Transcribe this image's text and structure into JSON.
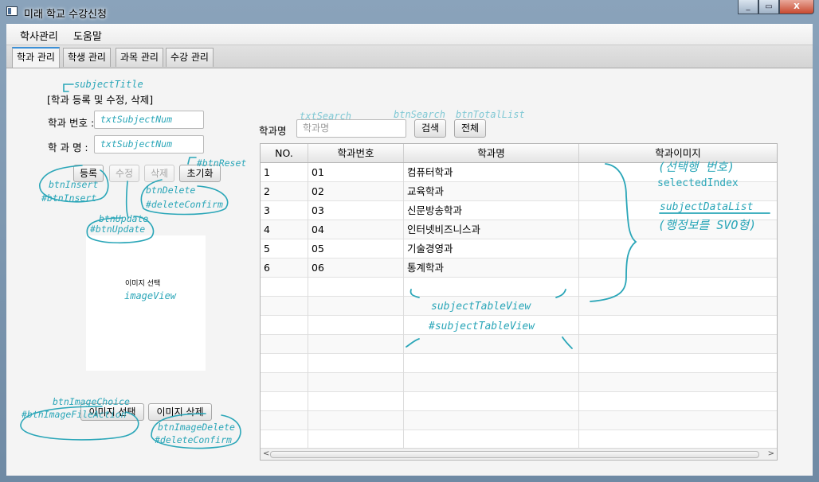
{
  "window": {
    "title": "미래 학교 수강신청",
    "minimize": "_",
    "maximize": "▭",
    "close": "X"
  },
  "menu": [
    "학사관리",
    "도움말"
  ],
  "tabs": [
    "학과 관리",
    "학생 관리",
    "과목 관리",
    "수강 관리"
  ],
  "form": {
    "title": "[학과 등록 및 수정, 삭제]",
    "num_label": "학과 번호 :",
    "name_label": "학 과 명 :",
    "num_placeholder": "txtSubjectNum",
    "name_placeholder": "txtSubjectNum",
    "buttons": {
      "insert": "등록",
      "update": "수정",
      "delete": "삭제",
      "reset": "초기화"
    },
    "image_placeholder": "이미지 선택",
    "image_choice": "이미지 선택",
    "image_delete": "이미지 삭제"
  },
  "search": {
    "label": "학과명",
    "placeholder": "학과명",
    "search_button": "검색",
    "total_button": "전체"
  },
  "table": {
    "columns": [
      "NO.",
      "학과번호",
      "학과명",
      "학과이미지"
    ],
    "rows": [
      {
        "no": "1",
        "num": "01",
        "name": "컴퓨터학과",
        "image": ""
      },
      {
        "no": "2",
        "num": "02",
        "name": "교육학과",
        "image": ""
      },
      {
        "no": "3",
        "num": "03",
        "name": "신문방송학과",
        "image": ""
      },
      {
        "no": "4",
        "num": "04",
        "name": "인터넷비즈니스과",
        "image": ""
      },
      {
        "no": "5",
        "num": "05",
        "name": "기술경영과",
        "image": ""
      },
      {
        "no": "6",
        "num": "06",
        "name": "통계학과",
        "image": ""
      }
    ],
    "empty_rows": 9,
    "scroll_left": "<",
    "scroll_right": ">"
  },
  "annotations": {
    "subjectTitle": "subjectTitle",
    "btnInsert1": "btnInsert",
    "btnInsert2": "#btnInsert",
    "btnUpdate1": "btnUpdate",
    "btnUpdate2": "#btnUpdate",
    "btnDelete1": "btnDelete",
    "btnDelete2": "#deleteConfirm",
    "btnReset": "#btnReset",
    "imageView": "imageView",
    "imgChoice1": "btnImageChoice",
    "imgChoice2": "#btnImageFileAction",
    "imgDelete1": "btnImageDelete",
    "imgDelete2": "#deleteConfirm",
    "txtSearch": "txtSearch",
    "btnSearch": "btnSearch",
    "btnTotalList": "btnTotalList",
    "selRow": "(선택행 번호)",
    "selectedIndex": "selectedIndex",
    "dataList": "subjectDataList",
    "dataListNote": "(행정보를 SVO형)",
    "tableView1": "subjectTableView",
    "tableView2": "#subjectTableView"
  },
  "colors": {
    "annotation": "#2aa6b8",
    "tab_accent": "#3a8fd6"
  }
}
